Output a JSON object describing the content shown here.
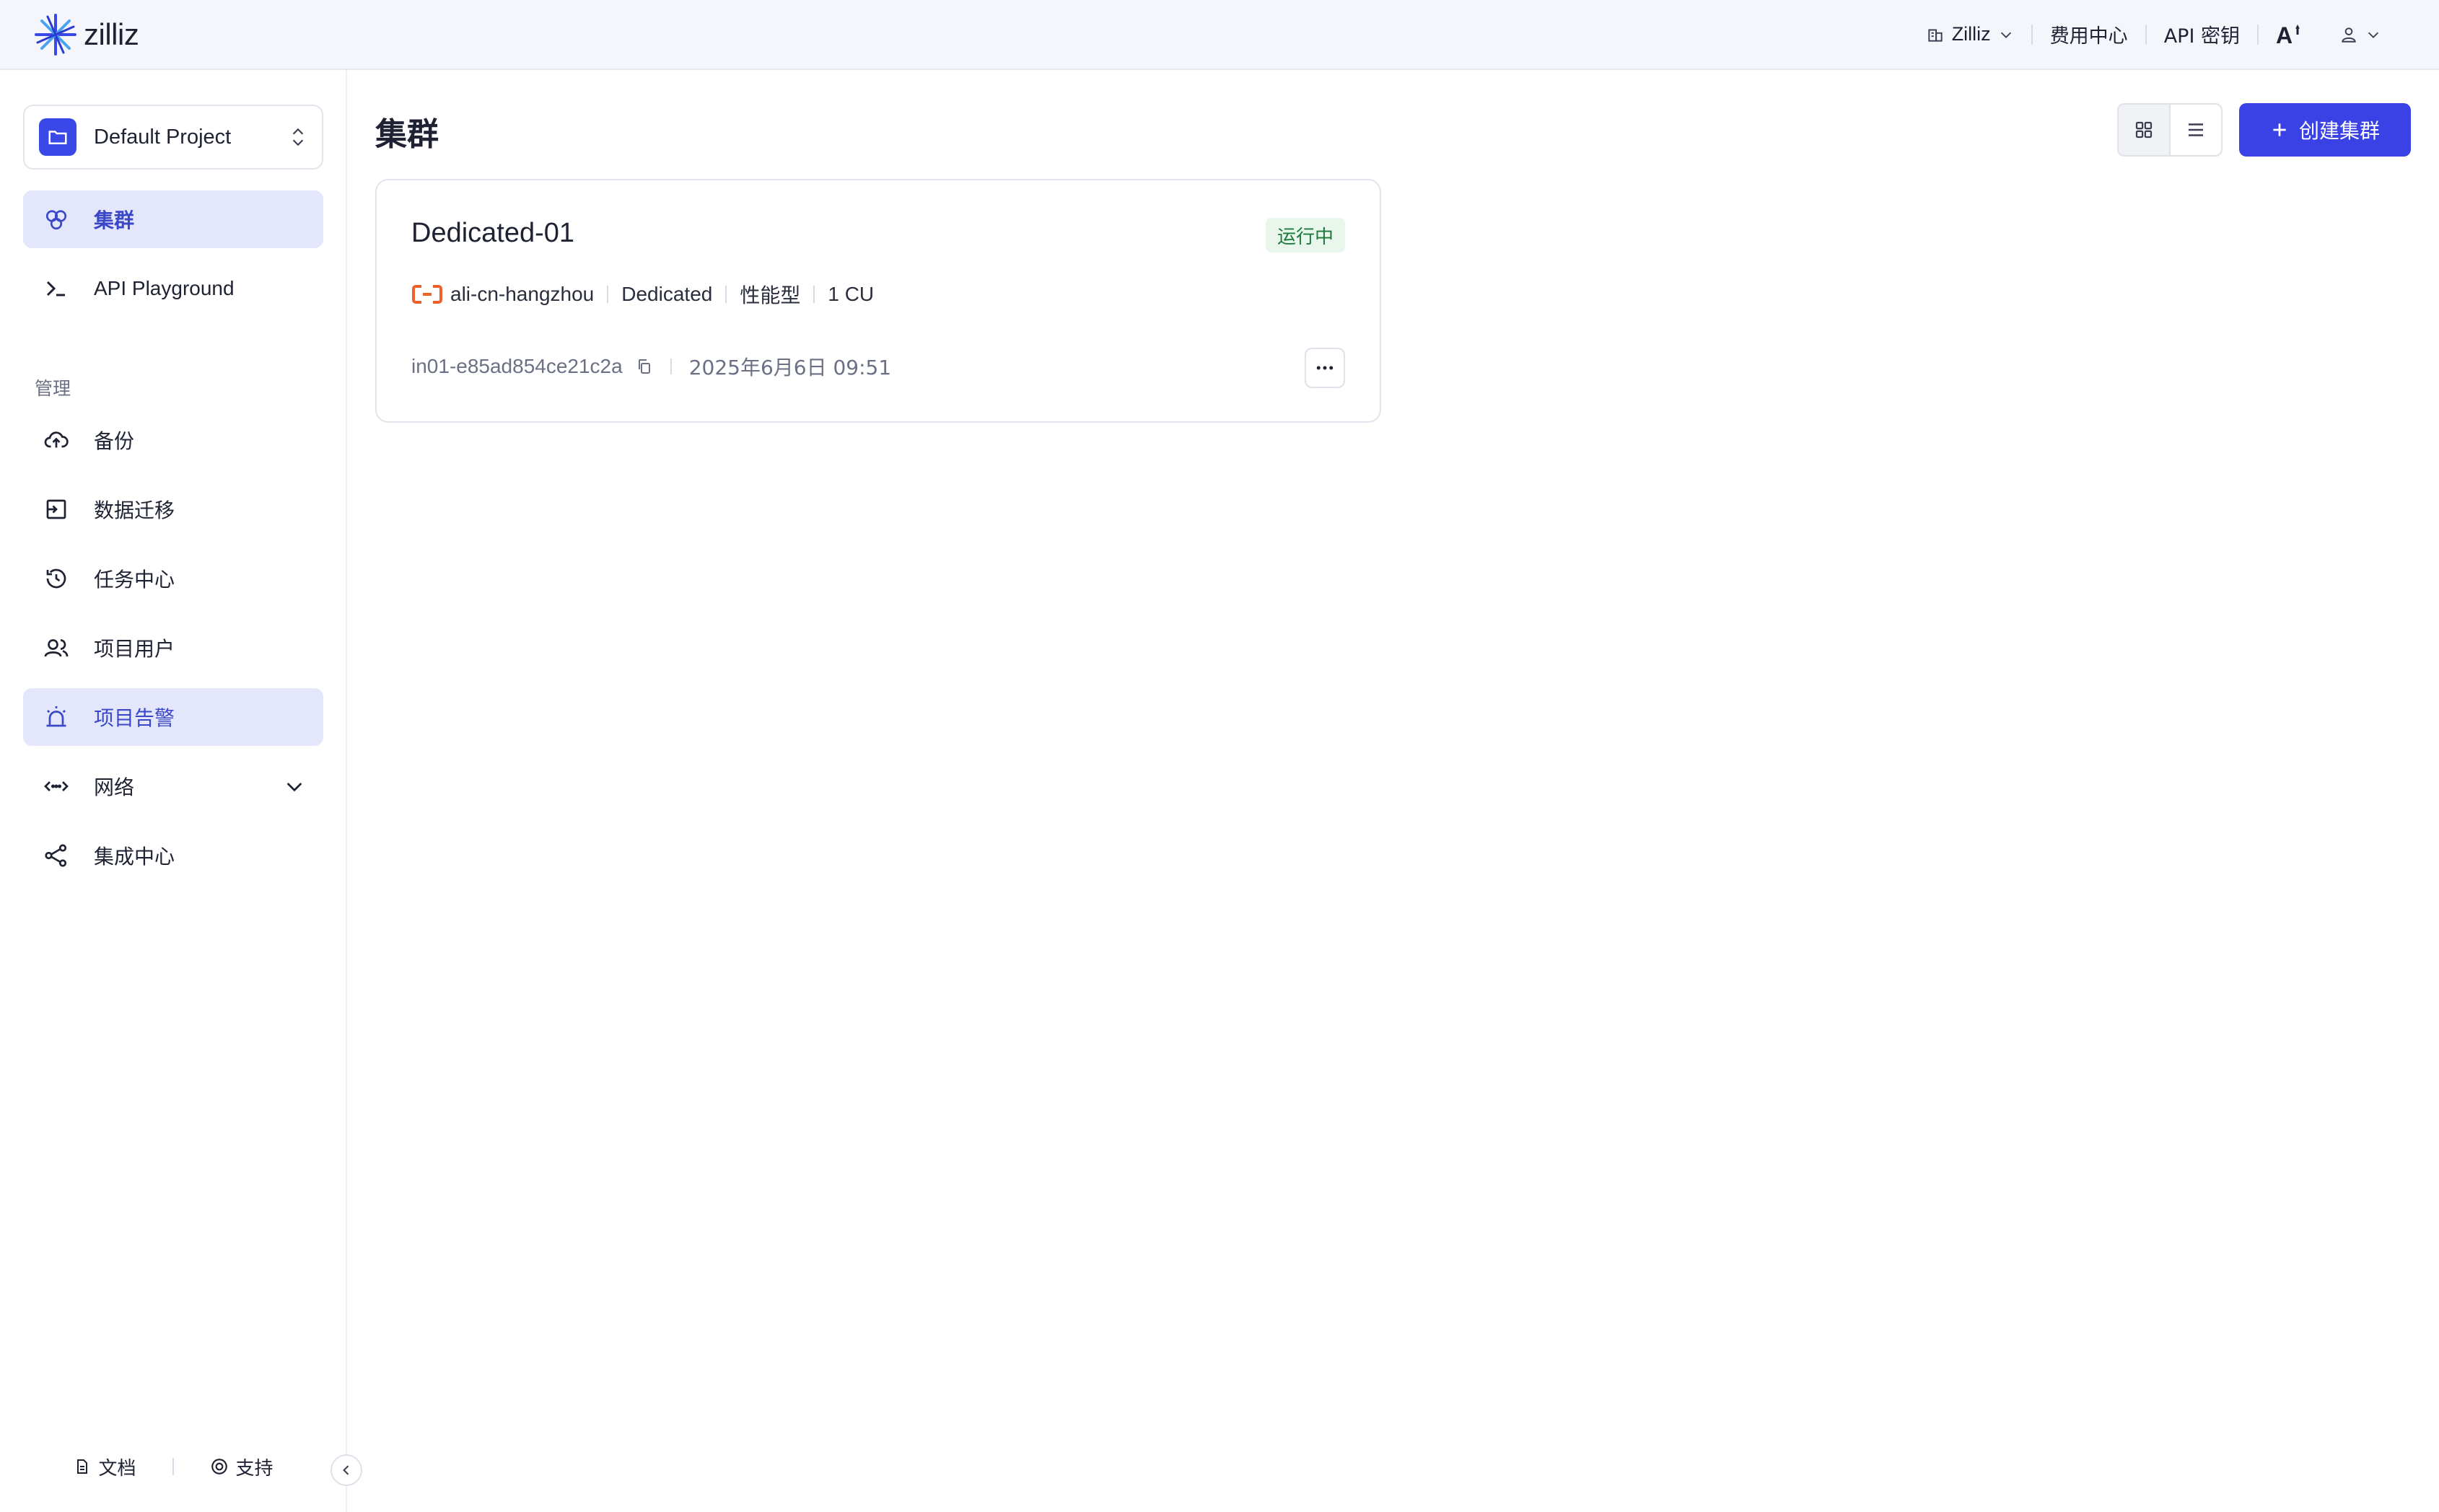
{
  "brand": {
    "name": "zilliz"
  },
  "topnav": {
    "org": "Zilliz",
    "billing": "费用中心",
    "api_keys": "API 密钥"
  },
  "sidebar": {
    "project": "Default Project",
    "items": [
      {
        "label": "集群",
        "icon": "cluster-icon"
      },
      {
        "label": "API Playground",
        "icon": "terminal-icon"
      }
    ],
    "section_label": "管理",
    "manage_items": [
      {
        "label": "备份",
        "icon": "cloud-upload-icon"
      },
      {
        "label": "数据迁移",
        "icon": "migrate-icon"
      },
      {
        "label": "任务中心",
        "icon": "history-icon"
      },
      {
        "label": "项目用户",
        "icon": "users-icon"
      },
      {
        "label": "项目告警",
        "icon": "alarm-icon"
      },
      {
        "label": "网络",
        "icon": "network-icon"
      },
      {
        "label": "集成中心",
        "icon": "share-icon"
      }
    ],
    "footer": {
      "docs": "文档",
      "support": "支持"
    }
  },
  "main": {
    "title": "集群",
    "create_button": "创建集群",
    "cluster": {
      "name": "Dedicated-01",
      "status": "运行中",
      "region": "ali-cn-hangzhou",
      "plan": "Dedicated",
      "type": "性能型",
      "cu": "1 CU",
      "id": "in01-e85ad854ce21c2a",
      "created": "2025年6月6日 09:51"
    }
  },
  "colors": {
    "accent": "#3a42e6",
    "active_bg": "#e4e7fb",
    "status_bg": "#e8f6ec",
    "status_text": "#1d7a3a",
    "aliyun_orange": "#f0612a"
  }
}
